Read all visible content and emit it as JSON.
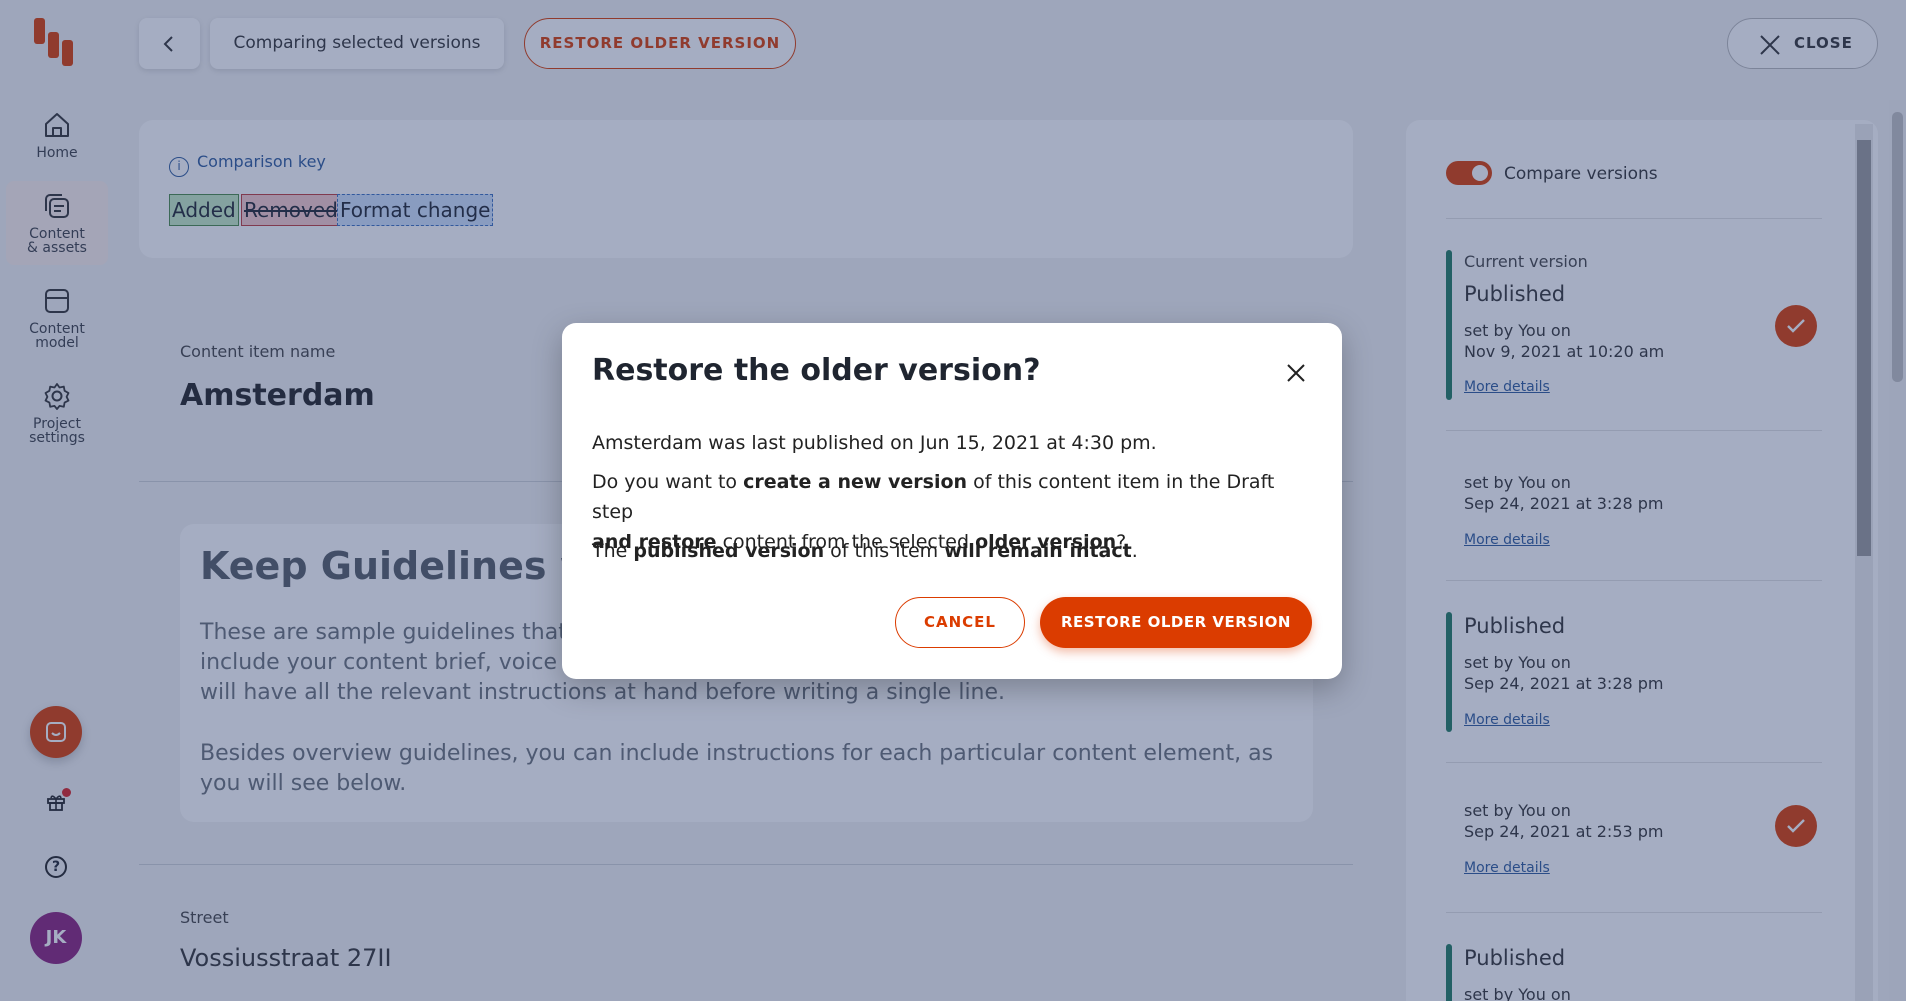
{
  "topbar": {
    "breadcrumb": "Comparing selected versions",
    "restore_label": "RESTORE OLDER VERSION",
    "close_label": "CLOSE"
  },
  "sidebar": {
    "items": [
      {
        "label": "Home",
        "icon": "home-icon"
      },
      {
        "label": "Content\n& assets",
        "icon": "content-icon"
      },
      {
        "label": "Content\nmodel",
        "icon": "model-icon"
      },
      {
        "label": "Project\nsettings",
        "icon": "gear-icon"
      }
    ],
    "avatar_initials": "JK"
  },
  "comparison_key": {
    "title": "Comparison key",
    "added": "Added",
    "removed": "Removed",
    "format": "Format change"
  },
  "item": {
    "name_label": "Content item name",
    "name_value": "Amsterdam",
    "guide_title": "Keep Guidelines whe",
    "guide_p1_line1": "These are sample guidelines that y",
    "guide_p1_line2": "include your content brief, voice ar",
    "guide_p1_line3": "will have all the relevant instructions at hand before writing a single line.",
    "guide_p2": "Besides overview guidelines, you can include instructions for each particular content element, as you will see below.",
    "street_label": "Street",
    "street_value": "Vossiusstraat 27II"
  },
  "versions_panel": {
    "toggle_label": "Compare versions",
    "versions": [
      {
        "heading": "Current version",
        "status": "Published",
        "set_by": "set by You on",
        "date": "Nov 9, 2021 at 10:20 am",
        "more": "More details"
      },
      {
        "status": "",
        "set_by": "set by You on",
        "date": "Sep 24, 2021 at 3:28 pm",
        "more": "More details"
      },
      {
        "status": "Published",
        "set_by": "set by You on",
        "date": "Sep 24, 2021 at 3:28 pm",
        "more": "More details"
      },
      {
        "status": "",
        "set_by": "set by You on",
        "date": "Sep 24, 2021 at 2:53 pm",
        "more": "More details"
      },
      {
        "status": "Published",
        "set_by": "set by You on"
      }
    ]
  },
  "modal": {
    "title": "Restore the older version?",
    "line1": "Amsterdam was last published on Jun 15, 2021 at 4:30 pm.",
    "q_a": "Do you want to ",
    "q_b": "create a new version",
    "q_c": " of this content item in the Draft step",
    "q_d": "and restore",
    "q_e": " content from the selected ",
    "q_f": "older version",
    "q_g": "?",
    "p_a": "The ",
    "p_b": "published version",
    "p_c": " of this item ",
    "p_d": "will remain intact",
    "p_e": ".",
    "cancel_label": "CANCEL",
    "confirm_label": "RESTORE OLDER VERSION"
  }
}
